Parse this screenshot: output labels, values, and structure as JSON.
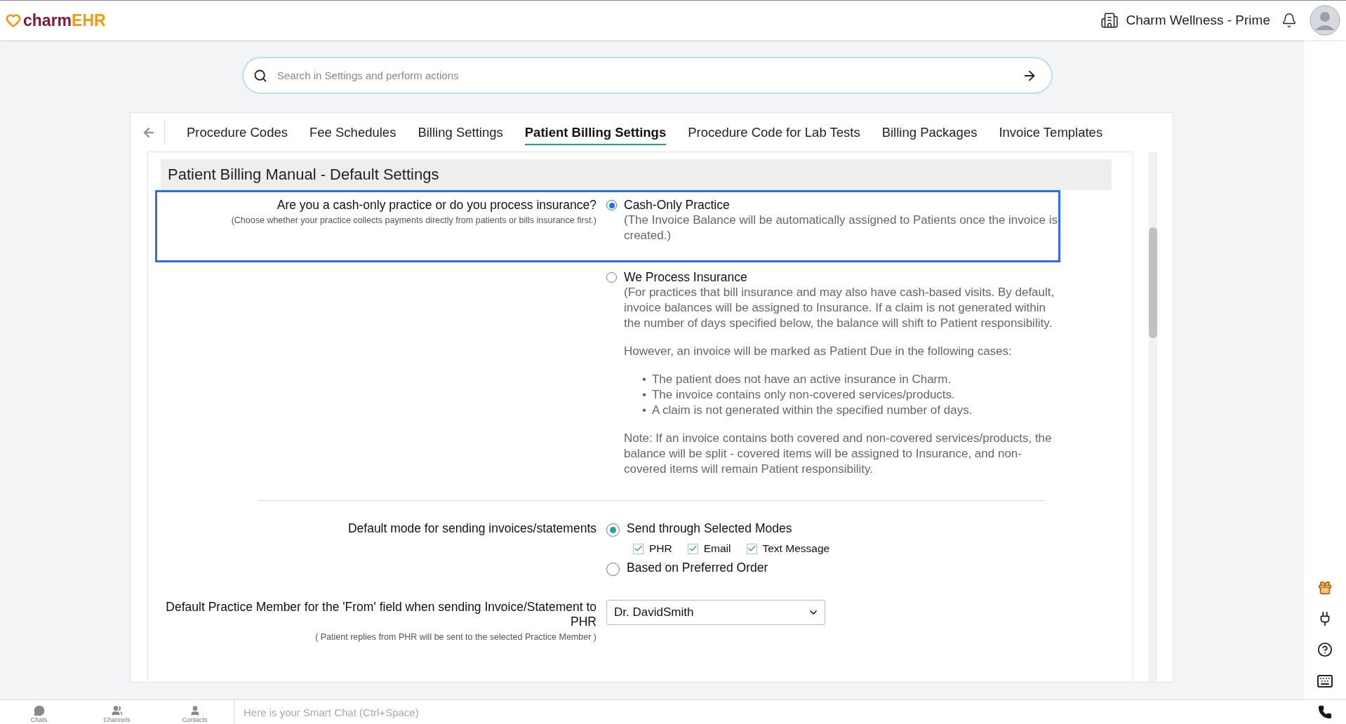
{
  "header": {
    "logo_main": "charm",
    "logo_suffix": "EHR",
    "practice": "Charm Wellness - Prime"
  },
  "search": {
    "placeholder": "Search in Settings and perform actions"
  },
  "tabs": [
    {
      "label": "Procedure Codes",
      "selected": false
    },
    {
      "label": "Fee Schedules",
      "selected": false
    },
    {
      "label": "Billing Settings",
      "selected": false
    },
    {
      "label": "Patient Billing Settings",
      "selected": true
    },
    {
      "label": "Procedure Code for Lab Tests",
      "selected": false
    },
    {
      "label": "Billing Packages",
      "selected": false
    },
    {
      "label": "Invoice Templates",
      "selected": false
    }
  ],
  "section": {
    "title": "Patient Billing Manual - Default Settings"
  },
  "insurance_question": {
    "label": "Are you a cash-only practice or do you process insurance?",
    "hint": "(Choose whether your practice collects payments directly from patients or bills insurance first.)",
    "highlighted": true,
    "options": [
      {
        "label": "Cash-Only Practice",
        "selected": true,
        "blocks": [
          {
            "kind": "paragraph",
            "text": "(The Invoice Balance will be automatically assigned to Patients once the invoice is created.)"
          }
        ]
      },
      {
        "label": "We Process Insurance",
        "selected": false,
        "blocks": [
          {
            "kind": "paragraph",
            "text": "(For practices that bill insurance and may also have cash-based visits. By default, invoice balances will be assigned to Insurance. If a claim is not generated within the number of days specified below, the balance will shift to Patient responsibility."
          },
          {
            "kind": "paragraph",
            "text": "However, an invoice will be marked as Patient Due in the following cases:"
          },
          {
            "kind": "list",
            "marker": "•",
            "items": [
              "The patient does not have an active insurance in Charm.",
              "The invoice contains only non-covered services/products.",
              "A claim is not generated within the specified number of days."
            ]
          },
          {
            "kind": "paragraph",
            "text": "Note: If an invoice contains both covered and non-covered services/products, the balance will be split - covered items will be assigned to Insurance, and non-covered items will remain Patient responsibility."
          }
        ]
      }
    ]
  },
  "send_mode": {
    "label": "Default mode for sending invoices/statements",
    "options": [
      {
        "label": "Send through Selected Modes",
        "selected": true,
        "checkboxes": [
          {
            "label": "PHR",
            "checked": true
          },
          {
            "label": "Email",
            "checked": true
          },
          {
            "label": "Text Message",
            "checked": true
          }
        ]
      },
      {
        "label": "Based on Preferred Order",
        "selected": false
      }
    ]
  },
  "from_member": {
    "label": "Default Practice Member for the 'From' field when sending Invoice/Statement to PHR",
    "hint": "( Patient replies from PHR will be sent to the selected Practice Member )",
    "value": "Dr. DavidSmith"
  },
  "chat_bar": {
    "tabs": [
      "Chats",
      "Channels",
      "Contacts"
    ],
    "placeholder": "Here is your Smart Chat (Ctrl+Space)"
  }
}
